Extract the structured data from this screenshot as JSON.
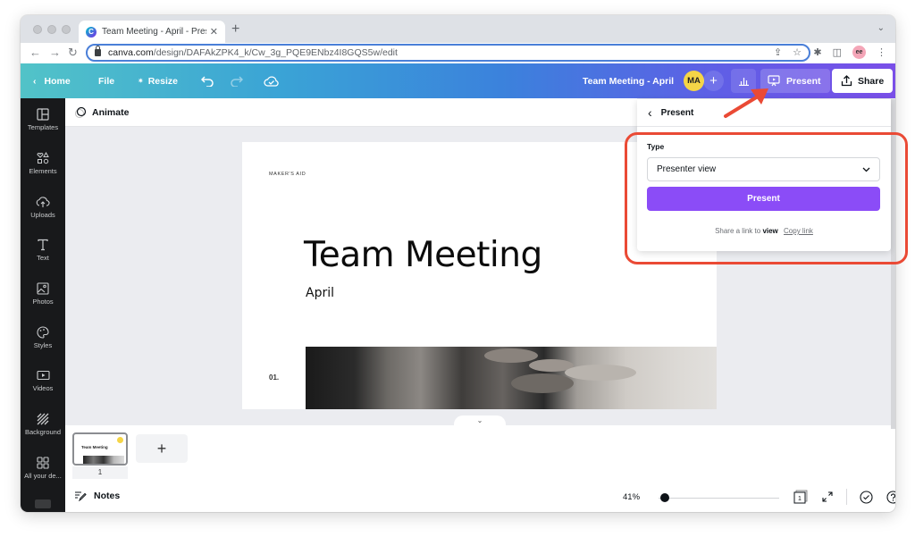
{
  "browser": {
    "tab_title": "Team Meeting - April - Present",
    "new_tab_label": "+",
    "url_host": "canva.com",
    "url_path": "/design/DAFAkZPK4_k/Cw_3g_PQE9ENbz4I8GQS5w/edit",
    "profile_initials": "ee",
    "favicon_letter": "C"
  },
  "header": {
    "home_label": "Home",
    "file_label": "File",
    "resize_label": "Resize",
    "design_title": "Team Meeting - April",
    "avatar_initials": "MA",
    "add_label": "+",
    "present_label": "Present",
    "share_label": "Share",
    "gradient_start": "#52c3c8",
    "gradient_end": "#7a4fe8"
  },
  "sidebar": {
    "items": [
      {
        "label": "Templates",
        "icon": "templates-icon"
      },
      {
        "label": "Elements",
        "icon": "elements-icon"
      },
      {
        "label": "Uploads",
        "icon": "uploads-icon"
      },
      {
        "label": "Text",
        "icon": "text-icon"
      },
      {
        "label": "Photos",
        "icon": "photos-icon"
      },
      {
        "label": "Styles",
        "icon": "styles-icon"
      },
      {
        "label": "Videos",
        "icon": "videos-icon"
      },
      {
        "label": "Background",
        "icon": "background-icon"
      },
      {
        "label": "All your de...",
        "icon": "apps-icon"
      }
    ]
  },
  "editor": {
    "animate_label": "Animate",
    "slide": {
      "brand": "MAKER'S AID",
      "title": "Team Meeting",
      "subtitle": "April",
      "number": "01."
    },
    "pages": [
      {
        "number": "1",
        "thumb_title": "Team Meeting"
      }
    ],
    "add_page_label": "+",
    "notes_label": "Notes",
    "zoom_percent": "41%",
    "zoom_value": 41,
    "page_count_label": "1"
  },
  "present_panel": {
    "back_label": "Present",
    "type_label": "Type",
    "type_value": "Presenter view",
    "present_button_label": "Present",
    "share_text_prefix": "Share a link to",
    "share_text_bold": "view",
    "copy_link_label": "Copy link",
    "button_color": "#8b4cf7"
  },
  "annotation": {
    "highlight_color": "#ea4a35"
  }
}
